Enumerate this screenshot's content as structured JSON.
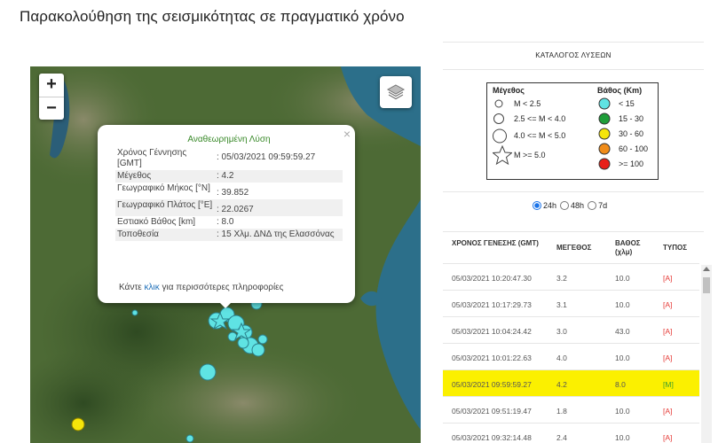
{
  "page": {
    "title": "Παρακολούθηση της σεισμικότητας σε πραγματικό χρόνο"
  },
  "map": {
    "zoom_in": "+",
    "zoom_out": "−",
    "layers_icon": "layers-icon",
    "popup": {
      "heading": "Αναθεωρημένη Λύση",
      "close": "×",
      "rows": [
        {
          "label": "Χρόνος Γέννησης [GMT]",
          "value": ": 05/03/2021 09:59:59.27"
        },
        {
          "label": "Μέγεθος",
          "value": ": 4.2"
        },
        {
          "label": "Γεωγραφικό Μήκος [°N]",
          "value": ": 39.852"
        },
        {
          "label": "Γεωγραφικό Πλάτος [°E]",
          "value": ": 22.0267"
        },
        {
          "label": "Εστιακό Βάθος [km]",
          "value": ": 8.0"
        },
        {
          "label": "Τοποθεσία",
          "value": ": 15 Χλμ. ΔΝΔ της Ελασσόνας"
        }
      ],
      "more_prefix": "Κάντε ",
      "more_link": "κλικ",
      "more_suffix": " για περισσότερες πληροφορίες"
    }
  },
  "catalog": {
    "title": "ΚΑΤΑΛΟΓΟΣ ΛΥΣΕΩΝ",
    "legend": {
      "magnitude_title": "Μέγεθος",
      "magnitudes": [
        "M < 2.5",
        "2.5 <= M < 4.0",
        "4.0 <= M < 5.0",
        "M >= 5.0"
      ],
      "depth_title": "Βάθος (Km)",
      "depths": [
        {
          "label": "< 15",
          "color": "#5fe3e3"
        },
        {
          "label": "15 - 30",
          "color": "#1f9e3a"
        },
        {
          "label": "30 - 60",
          "color": "#f5e50a"
        },
        {
          "label": "60 - 100",
          "color": "#f08c1a"
        },
        {
          "label": ">= 100",
          "color": "#e8201a"
        }
      ]
    },
    "ranges": {
      "r24": "24h",
      "r48": "48h",
      "r7d": "7d",
      "selected": "24h"
    },
    "table": {
      "headers": {
        "time": "ΧΡΟΝΟΣ ΓΕΝΕΣΗΣ (GMT)",
        "mag": "ΜΕΓΕΘΟΣ",
        "depth": "ΒΑΘΟΣ (χλμ)",
        "type": "ΤΥΠΟΣ"
      },
      "rows": [
        {
          "time": "05/03/2021 10:20:47.30",
          "mag": "3.2",
          "depth": "10.0",
          "type": "[A]"
        },
        {
          "time": "05/03/2021 10:17:29.73",
          "mag": "3.1",
          "depth": "10.0",
          "type": "[A]"
        },
        {
          "time": "05/03/2021 10:04:24.42",
          "mag": "3.0",
          "depth": "43.0",
          "type": "[A]"
        },
        {
          "time": "05/03/2021 10:01:22.63",
          "mag": "4.0",
          "depth": "10.0",
          "type": "[A]"
        },
        {
          "time": "05/03/2021 09:59:59.27",
          "mag": "4.2",
          "depth": "8.0",
          "type": "[M]"
        },
        {
          "time": "05/03/2021 09:51:19.47",
          "mag": "1.8",
          "depth": "10.0",
          "type": "[A]"
        },
        {
          "time": "05/03/2021 09:32:14.48",
          "mag": "2.4",
          "depth": "10.0",
          "type": "[A]"
        }
      ]
    }
  },
  "colors": {
    "highlight": "#fbf000",
    "manual": "#3b9e2e",
    "automatic": "#e53935",
    "link": "#1e6fb8",
    "quake": "#5fe3e3"
  }
}
